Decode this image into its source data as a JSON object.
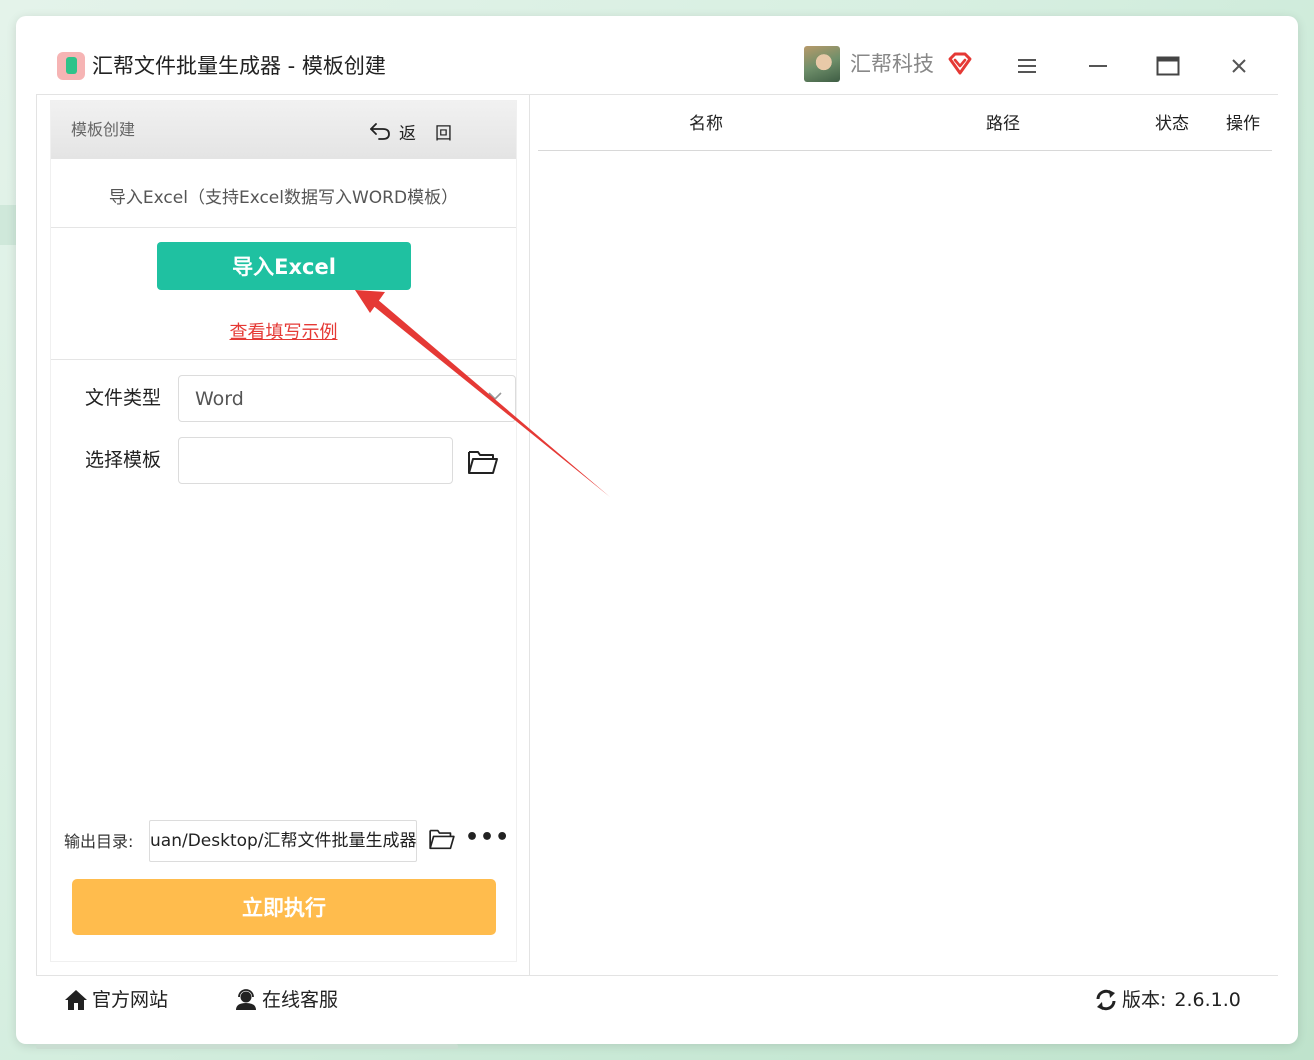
{
  "window": {
    "app_title": "汇帮文件批量生成器 - 模板创建",
    "company": "汇帮科技"
  },
  "panel": {
    "header_title": "模板创建",
    "back_label": "返回",
    "excel_description": "导入Excel（支持Excel数据写入WORD模板）",
    "import_button": "导入Excel",
    "example_link": "查看填写示例",
    "file_type_label": "文件类型",
    "file_type_value": "Word",
    "select_template_label": "选择模板",
    "select_template_value": "",
    "output_dir_label": "输出目录:",
    "output_dir_value": "uan/Desktop/汇帮文件批量生成器",
    "more_label": "•••",
    "run_button": "立即执行"
  },
  "table": {
    "columns": [
      "名称",
      "路径",
      "状态",
      "操作"
    ],
    "rows": []
  },
  "footer": {
    "official_site": "官方网站",
    "online_service": "在线客服",
    "version_label": "版本:",
    "version_value": "2.6.1.0"
  },
  "colors": {
    "import_button": "#1fc1a1",
    "run_button": "#ffbc4d",
    "link": "#e53935",
    "annotation_arrow": "#e53935",
    "vip_icon": "#e53935"
  },
  "icons": {
    "back": "undo-arrow-icon",
    "menu": "hamburger-icon",
    "minimize": "minimize-icon",
    "maximize": "maximize-icon",
    "close": "close-icon",
    "folder": "folder-open-icon",
    "home": "home-icon",
    "service": "headset-user-icon",
    "version": "refresh-icon",
    "vip": "vip-diamond-icon"
  }
}
